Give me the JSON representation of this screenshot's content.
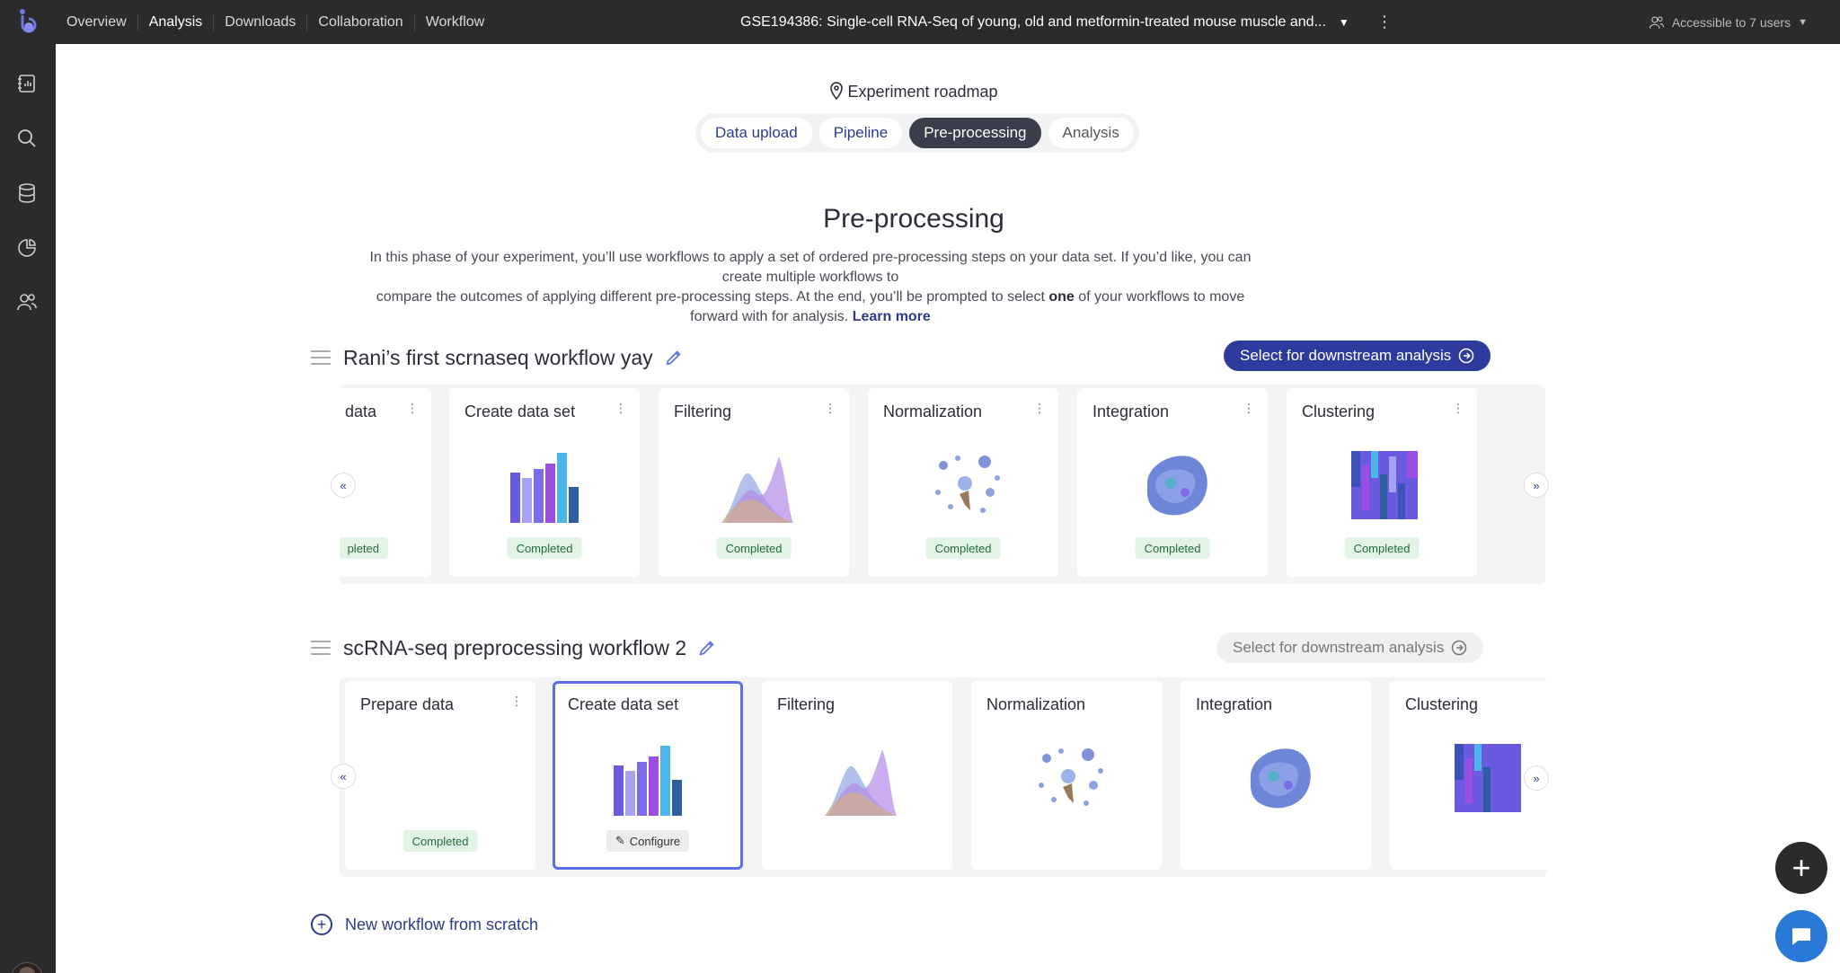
{
  "topbar": {
    "nav": [
      "Overview",
      "Analysis",
      "Downloads",
      "Collaboration",
      "Workflow"
    ],
    "active_nav": "Analysis",
    "experiment_title": "GSE194386: Single-cell RNA-Seq of young, old and metformin-treated mouse muscle and...",
    "access_text": "Accessible to 7 users"
  },
  "sidebar": {
    "icons": [
      "notebook-icon",
      "search-icon",
      "database-icon",
      "pie-chart-icon",
      "users-icon"
    ]
  },
  "roadmap": {
    "label": "Experiment roadmap",
    "steps": [
      "Data upload",
      "Pipeline",
      "Pre-processing",
      "Analysis"
    ],
    "active_step": "Pre-processing"
  },
  "page": {
    "title": "Pre-processing",
    "intro_line1": "In this phase of your experiment, you’ll use workflows to apply a set of ordered pre-processing steps on your data set. If you’d like, you can create multiple workflows to",
    "intro_line2a": "compare the outcomes of applying different pre-processing steps. At the end, you’ll be prompted to select",
    "intro_bold": "one",
    "intro_line2b": "of your workflows to move forward with for analysis.",
    "learn_more": "Learn more"
  },
  "workflows": [
    {
      "name": "Rani’s first scrnaseq workflow yay",
      "select_label": "Select for downstream analysis",
      "select_enabled": true,
      "cards": [
        {
          "title": "data",
          "status": "pleted"
        },
        {
          "title": "Create data set",
          "status": "Completed",
          "thumb": "bars"
        },
        {
          "title": "Filtering",
          "status": "Completed",
          "thumb": "density"
        },
        {
          "title": "Normalization",
          "status": "Completed",
          "thumb": "scatter"
        },
        {
          "title": "Integration",
          "status": "Completed",
          "thumb": "umap"
        },
        {
          "title": "Clustering",
          "status": "Completed",
          "thumb": "heatmap"
        }
      ]
    },
    {
      "name": "scRNA-seq preprocessing workflow 2",
      "select_label": "Select for downstream analysis",
      "select_enabled": false,
      "cards": [
        {
          "title": "Prepare data",
          "status": "Completed"
        },
        {
          "title": "Create data set",
          "status": "Configure",
          "thumb": "bars"
        },
        {
          "title": "Filtering",
          "status": "",
          "thumb": "density"
        },
        {
          "title": "Normalization",
          "status": "",
          "thumb": "scatter"
        },
        {
          "title": "Integration",
          "status": "",
          "thumb": "umap"
        },
        {
          "title": "Clustering",
          "status": "",
          "thumb": "heatmap"
        }
      ]
    }
  ],
  "new_workflow_label": "New workflow from scratch",
  "colors": {
    "primary": "#2e3b9e",
    "dark": "#2b2b2b",
    "success_bg": "#e1f4e6",
    "success_text": "#256b3b",
    "selected_border": "#5b6ee8"
  }
}
